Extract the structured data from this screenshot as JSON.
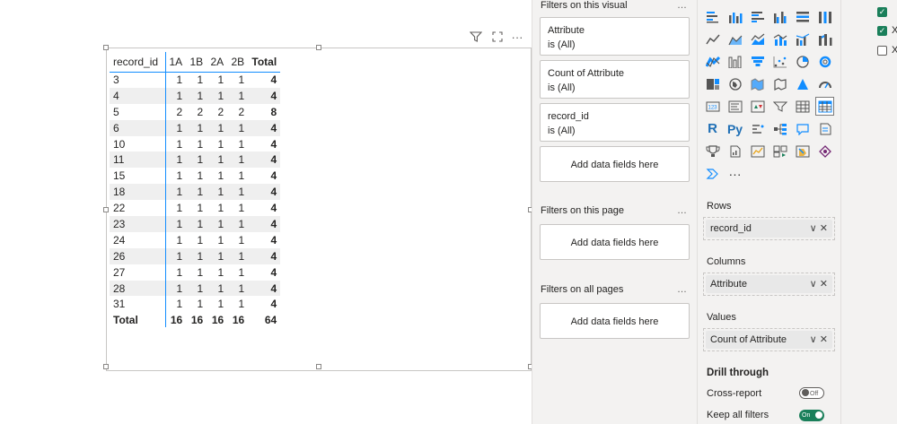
{
  "matrix": {
    "headers": {
      "record_id": "record_id",
      "c1": "1A",
      "c2": "1B",
      "c3": "2A",
      "c4": "2B",
      "total": "Total"
    },
    "rows": [
      {
        "id": "3",
        "v": [
          "1",
          "1",
          "1",
          "1"
        ],
        "total": "4"
      },
      {
        "id": "4",
        "v": [
          "1",
          "1",
          "1",
          "1"
        ],
        "total": "4"
      },
      {
        "id": "5",
        "v": [
          "2",
          "2",
          "2",
          "2"
        ],
        "total": "8"
      },
      {
        "id": "6",
        "v": [
          "1",
          "1",
          "1",
          "1"
        ],
        "total": "4"
      },
      {
        "id": "10",
        "v": [
          "1",
          "1",
          "1",
          "1"
        ],
        "total": "4"
      },
      {
        "id": "11",
        "v": [
          "1",
          "1",
          "1",
          "1"
        ],
        "total": "4"
      },
      {
        "id": "15",
        "v": [
          "1",
          "1",
          "1",
          "1"
        ],
        "total": "4"
      },
      {
        "id": "18",
        "v": [
          "1",
          "1",
          "1",
          "1"
        ],
        "total": "4"
      },
      {
        "id": "22",
        "v": [
          "1",
          "1",
          "1",
          "1"
        ],
        "total": "4"
      },
      {
        "id": "23",
        "v": [
          "1",
          "1",
          "1",
          "1"
        ],
        "total": "4"
      },
      {
        "id": "24",
        "v": [
          "1",
          "1",
          "1",
          "1"
        ],
        "total": "4"
      },
      {
        "id": "26",
        "v": [
          "1",
          "1",
          "1",
          "1"
        ],
        "total": "4"
      },
      {
        "id": "27",
        "v": [
          "1",
          "1",
          "1",
          "1"
        ],
        "total": "4"
      },
      {
        "id": "28",
        "v": [
          "1",
          "1",
          "1",
          "1"
        ],
        "total": "4"
      },
      {
        "id": "31",
        "v": [
          "1",
          "1",
          "1",
          "1"
        ],
        "total": "4"
      }
    ],
    "footer": {
      "label": "Total",
      "v": [
        "16",
        "16",
        "16",
        "16"
      ],
      "total": "64"
    }
  },
  "filters": {
    "visual_title": "Filters on this visual",
    "page_title": "Filters on this page",
    "all_title": "Filters on all pages",
    "dots": "…",
    "cards": [
      {
        "name": "Attribute",
        "state": "is (All)"
      },
      {
        "name": "Count of Attribute",
        "state": "is (All)"
      },
      {
        "name": "record_id",
        "state": "is (All)"
      }
    ],
    "add_label": "Add data fields here"
  },
  "viz": {
    "more": "···",
    "rows_label": "Rows",
    "rows_field": "record_id",
    "columns_label": "Columns",
    "columns_field": "Attribute",
    "values_label": "Values",
    "values_field": "Count of Attribute",
    "drill_label": "Drill through",
    "cross_report": "Cross-report",
    "cross_state": "Off",
    "keep_filters": "Keep all filters",
    "keep_state": "On",
    "pill_controls": "∨ ✕",
    "r_label": "R",
    "py_label": "Py",
    "card_label": "123"
  },
  "right_pane": {
    "items": [
      "X",
      "X",
      ""
    ]
  },
  "colors": {
    "accent": "#118dff",
    "toggle_on": "#1a7f5a"
  }
}
